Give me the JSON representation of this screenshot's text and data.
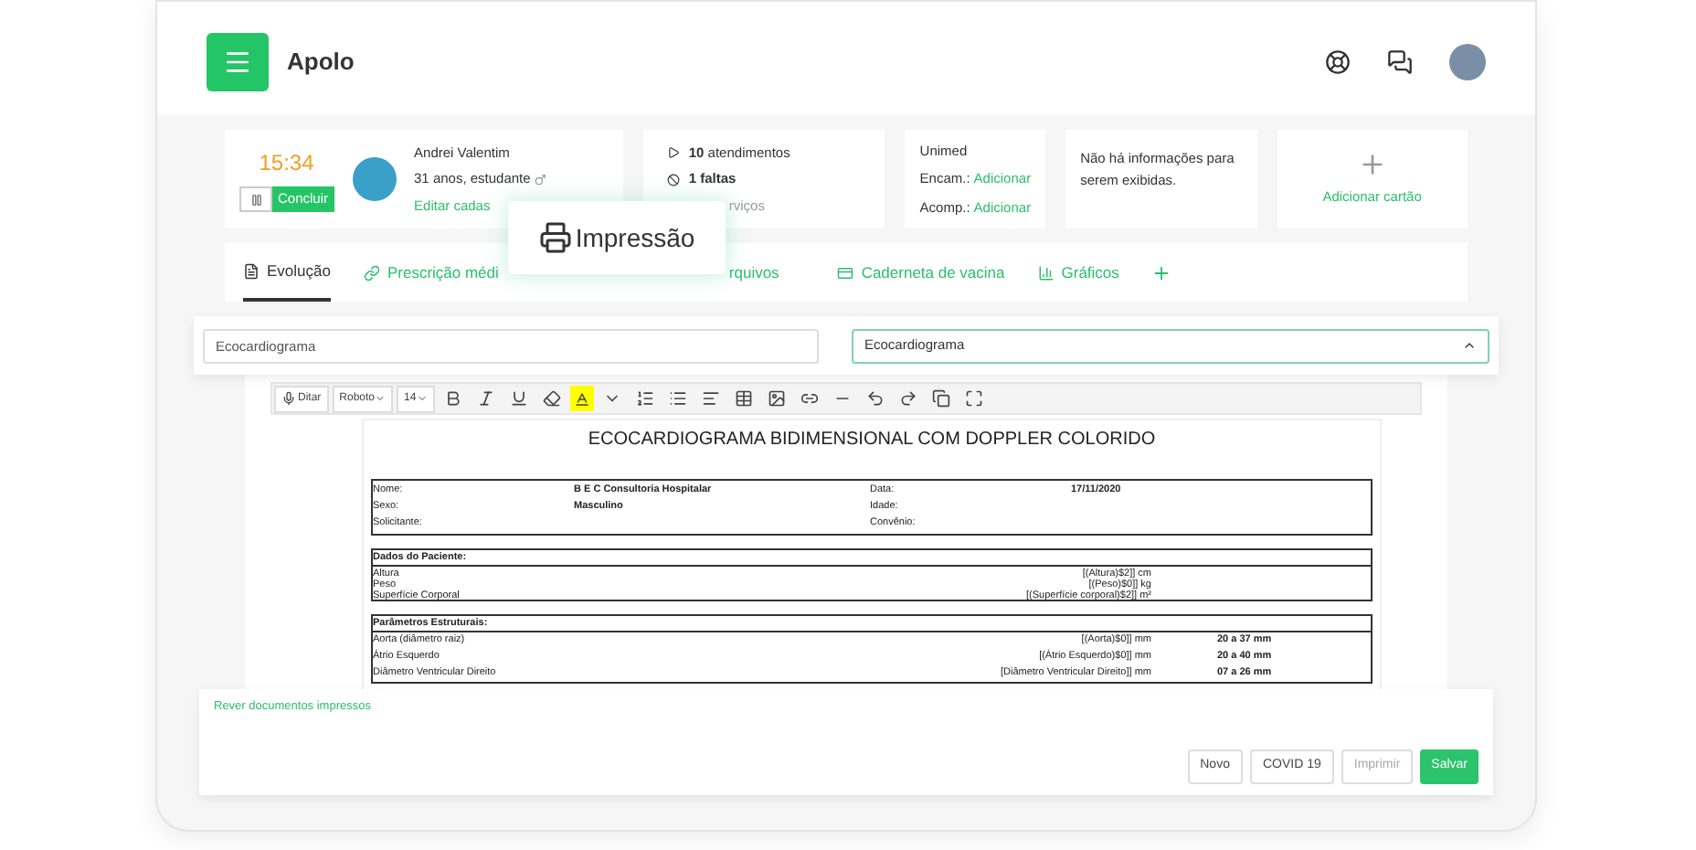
{
  "app": {
    "title": "Apolo"
  },
  "timer": {
    "time": "15:34",
    "action": "Concluir"
  },
  "patient": {
    "name": "Andrei Valentim",
    "info": "31 anos, estudante",
    "link": "Editar cadas"
  },
  "stats": [
    {
      "kind": "play",
      "count": "10",
      "label": "atendimentos"
    },
    {
      "kind": "ban",
      "count": "1 faltas"
    }
  ],
  "stats_tail": "rviços",
  "insurance": {
    "name": "Unimed",
    "rows": [
      {
        "label": "Encam.:",
        "link": "Adicionar"
      },
      {
        "label": "Acomp.:",
        "link": "Adicionar"
      }
    ]
  },
  "notice": "Não há informações para serem exibidas.",
  "add_card": "Adicionar cartão",
  "tabs": [
    {
      "kind": "doc",
      "label": "Evolução",
      "selected": true
    },
    {
      "kind": "link",
      "label": "Prescrição médi",
      "selected": false
    },
    {
      "kind": "none",
      "label": "rquivos",
      "selected": false
    },
    {
      "kind": "card",
      "label": "Caderneta de vacina",
      "selected": false
    },
    {
      "kind": "chart",
      "label": "Gráficos",
      "selected": false
    }
  ],
  "popup": {
    "label": "Impressão"
  },
  "template_field": {
    "value": "Ecocardiograma"
  },
  "template_select": {
    "value": "Ecocardiograma",
    "expanded": true
  },
  "toolbar": {
    "dictate": "Ditar",
    "font": "Roboto",
    "size": "14"
  },
  "document": {
    "title": "ECOCARDIOGRAMA BIDIMENSIONAL COM DOPPLER COLORIDO",
    "info": [
      {
        "label": "Nome:",
        "value": "B E C Consultoria Hospitalar"
      },
      {
        "label": "Data:",
        "value": "17/11/2020"
      },
      {
        "label": "Sexo:",
        "value": "Masculino"
      },
      {
        "label": "Idade:"
      },
      {
        "label": "Solicitante:"
      },
      {
        "label": "Convênio:"
      }
    ],
    "sections": [
      {
        "title": "Dados do Paciente:",
        "rows": [
          [
            "Altura",
            "[(Altura)$2]] cm",
            ""
          ],
          [
            "Peso",
            "[(Peso)$0]] kg",
            ""
          ],
          [
            "Superfície Corporal",
            "[(Superfície corporal)$2]] m²",
            ""
          ]
        ]
      },
      {
        "title": "Parâmetros Estruturais:",
        "rows": [
          [
            "Aorta (diâmetro raiz)",
            "[(Aorta)$0]] mm",
            "20 a 37 mm"
          ],
          [
            "Átrio Esquerdo",
            "[(Átrio Esquerdo)$0]] mm",
            "20 a 40 mm"
          ],
          [
            "Diâmetro Ventricular Direito",
            "[Diâmetro Ventricular Direito]] mm",
            "07 a 26 mm"
          ]
        ]
      }
    ]
  },
  "footer": {
    "link": "Rever documentos impressos",
    "buttons": [
      {
        "kind": "default",
        "label": "Novo",
        "disabled": false
      },
      {
        "kind": "default",
        "label": "COVID 19",
        "disabled": false
      },
      {
        "kind": "default",
        "label": "Imprimir",
        "disabled": true
      },
      {
        "kind": "primary",
        "label": "Salvar",
        "disabled": false
      }
    ]
  }
}
